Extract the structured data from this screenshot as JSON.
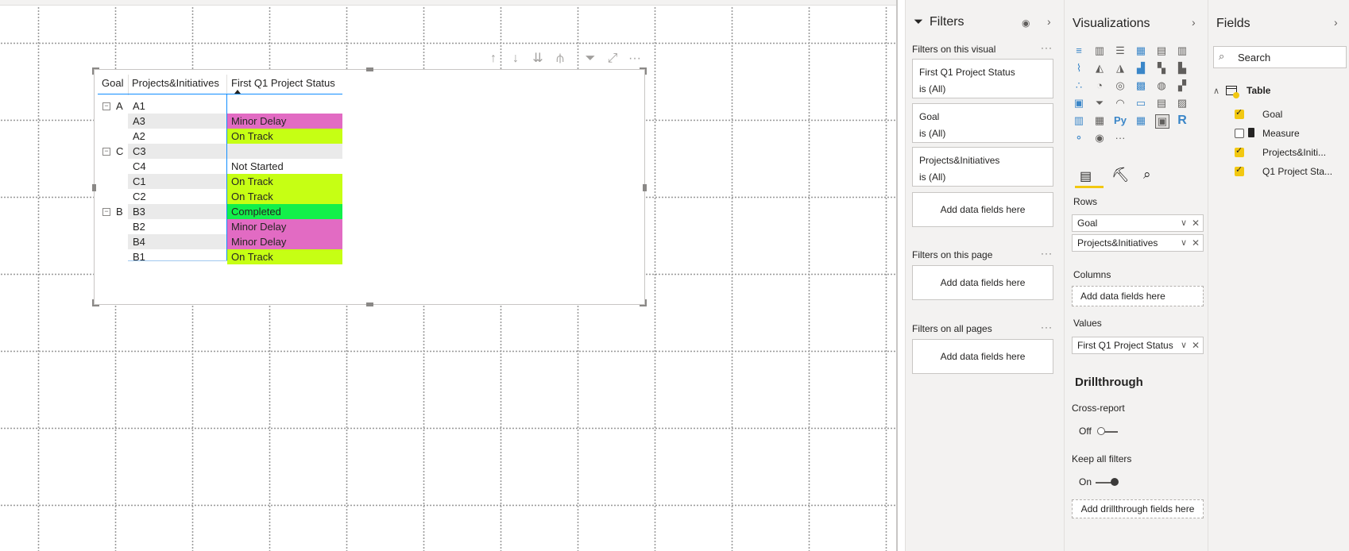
{
  "table": {
    "headers": [
      "Goal",
      "Projects&Initiatives",
      "First Q1 Project Status"
    ],
    "rows": [
      {
        "goal": "A",
        "project": "A1",
        "status": "",
        "color": ""
      },
      {
        "goal": "",
        "project": "A3",
        "status": "Minor Delay",
        "color": "#e26bc3"
      },
      {
        "goal": "",
        "project": "A2",
        "status": "On Track",
        "color": "#c6ff14"
      },
      {
        "goal": "C",
        "project": "C3",
        "status": "",
        "color": ""
      },
      {
        "goal": "",
        "project": "C4",
        "status": "Not Started",
        "color": ""
      },
      {
        "goal": "",
        "project": "C1",
        "status": "On Track",
        "color": "#c6ff14"
      },
      {
        "goal": "",
        "project": "C2",
        "status": "On Track",
        "color": "#c6ff14"
      },
      {
        "goal": "B",
        "project": "B3",
        "status": "Completed",
        "color": "#12f04a"
      },
      {
        "goal": "",
        "project": "B2",
        "status": "Minor Delay",
        "color": "#e26bc3"
      },
      {
        "goal": "",
        "project": "B4",
        "status": "Minor Delay",
        "color": "#e26bc3"
      },
      {
        "goal": "",
        "project": "B1",
        "status": "On Track",
        "color": "#c6ff14"
      }
    ]
  },
  "toolbar": {
    "icons": [
      "arrow-up-icon",
      "arrow-down-icon",
      "double-arrow-down-icon",
      "expand-hierarchy-icon",
      "filter-icon",
      "focus-mode-icon",
      "more-options-icon"
    ],
    "more": "···"
  },
  "filters": {
    "title": "Filters",
    "on_visual": "Filters on this visual",
    "cards": [
      {
        "name": "First Q1 Project Status",
        "value": "is (All)"
      },
      {
        "name": "Goal",
        "value": "is (All)"
      },
      {
        "name": "Projects&Initiatives",
        "value": "is (All)"
      }
    ],
    "add": "Add data fields here",
    "on_page": "Filters on this page",
    "on_all": "Filters on all pages",
    "dots": "···"
  },
  "viz": {
    "title": "Visualizations",
    "rows_label": "Rows",
    "rows": [
      "Goal",
      "Projects&Initiatives"
    ],
    "columns_label": "Columns",
    "columns_add": "Add data fields here",
    "values_label": "Values",
    "values": [
      "First Q1 Project Status"
    ],
    "drill_title": "Drillthrough",
    "cross_label": "Cross-report",
    "cross_state": "Off",
    "keep_label": "Keep all filters",
    "keep_state": "On",
    "drill_add": "Add drillthrough fields here",
    "py": "Py",
    "r": "R",
    "more": "···"
  },
  "fields": {
    "title": "Fields",
    "search_placeholder": "Search",
    "table_name": "Table",
    "items": [
      {
        "name": "Goal",
        "checked": true
      },
      {
        "name": "Measure",
        "checked": false
      },
      {
        "name": "Projects&Initi...",
        "checked": true
      },
      {
        "name": "Q1 Project Sta...",
        "checked": true
      }
    ]
  }
}
